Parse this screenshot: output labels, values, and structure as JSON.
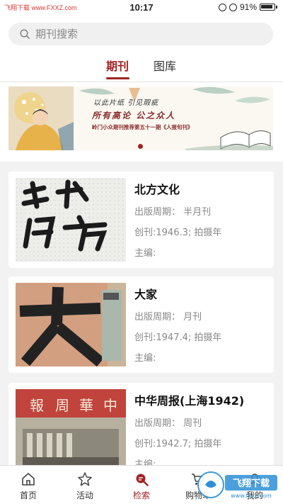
{
  "status_bar": {
    "carrier": "飞翔下载 www.FXXZ.com",
    "time": "10:17",
    "battery": "91%"
  },
  "search": {
    "placeholder": "期刊搜索"
  },
  "tabs": [
    {
      "label": "期刊",
      "active": true
    },
    {
      "label": "图库",
      "active": false
    }
  ],
  "banner": {
    "line1": "以此片纸   引见瑕疵",
    "line2": "所有高论   公之众人",
    "line3": "岭门小众期刊推荐第五十一期《人报旬刊》",
    "page_index": 1,
    "page_count": 1
  },
  "journals": [
    {
      "title": "北方文化",
      "period": "出版周期：  半月刊",
      "founded": "创刊:1946.3; 拍摄年",
      "editor": "主编:",
      "cover_text": "北方文化"
    },
    {
      "title": "大家",
      "period": "出版周期：  月刊",
      "founded": "创刊:1947.4; 拍摄年",
      "editor": "主编:",
      "cover_text": "大"
    },
    {
      "title": "中华周报(上海1942)",
      "period": "出版周期：  周刊",
      "founded": "创刊:1942.7; 拍摄年",
      "editor": "主编:",
      "cover_text": "中華周報"
    }
  ],
  "bottom_nav": [
    {
      "label": "首页",
      "icon": "home-icon",
      "active": false
    },
    {
      "label": "活动",
      "icon": "star-icon",
      "active": false
    },
    {
      "label": "检索",
      "icon": "search-icon",
      "active": true
    },
    {
      "label": "购物车",
      "icon": "cart-icon",
      "active": false
    },
    {
      "label": "我的",
      "icon": "user-icon",
      "active": false
    }
  ],
  "watermark": {
    "brand": "飞翔下载",
    "url": "www.fxxz.com"
  },
  "colors": {
    "accent": "#a32323",
    "background": "#f2f2f2"
  }
}
